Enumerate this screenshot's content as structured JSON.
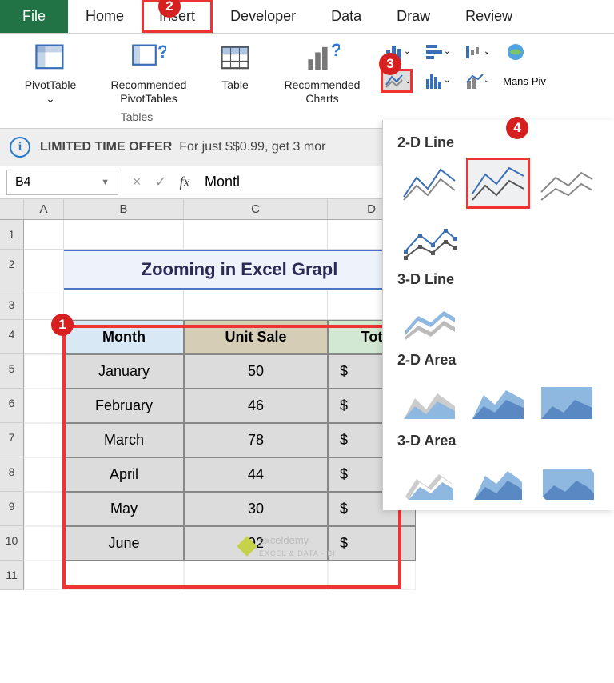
{
  "tabs": {
    "file": "File",
    "items": [
      "Home",
      "Insert",
      "Developer",
      "Data",
      "Draw",
      "Review"
    ],
    "active": "Insert"
  },
  "ribbon": {
    "tables": {
      "label": "Tables",
      "pivot": "PivotTable",
      "recommended": "Recommended PivotTables",
      "table": "Table"
    },
    "charts": {
      "recommended": "Recommended Charts",
      "maps": "Mans",
      "piv": "Piv"
    }
  },
  "infobar": {
    "bold": "LIMITED TIME OFFER",
    "rest": "For just $$0.99, get 3 mor"
  },
  "fxbar": {
    "namebox": "B4",
    "formula": "Montl"
  },
  "columns": [
    "",
    "A",
    "B",
    "C",
    "D"
  ],
  "rows": [
    "1",
    "2",
    "3",
    "4",
    "5",
    "6",
    "7",
    "8",
    "9",
    "10",
    "11"
  ],
  "titleCell": "Zooming in Excel Grapl",
  "table": {
    "headers": [
      "Month",
      "Unit Sale",
      "Tot"
    ],
    "rows": [
      [
        "January",
        "50",
        "$"
      ],
      [
        "February",
        "46",
        "$"
      ],
      [
        "March",
        "78",
        "$"
      ],
      [
        "April",
        "44",
        "$"
      ],
      [
        "May",
        "30",
        "$"
      ],
      [
        "June",
        "92",
        "$"
      ]
    ]
  },
  "dropdown": {
    "h1": "2-D Line",
    "h2": "3-D Line",
    "h3": "2-D Area",
    "h4": "3-D Area"
  },
  "steps": {
    "s1": "1",
    "s2": "2",
    "s3": "3",
    "s4": "4"
  },
  "chart_data": {
    "type": "table",
    "title": "Zooming in Excel Graph",
    "columns": [
      "Month",
      "Unit Sale"
    ],
    "categories": [
      "January",
      "February",
      "March",
      "April",
      "May",
      "June"
    ],
    "values": [
      50,
      46,
      78,
      44,
      30,
      92
    ]
  },
  "watermark": {
    "name": "exceldemy",
    "sub": "EXCEL & DATA - BI"
  }
}
